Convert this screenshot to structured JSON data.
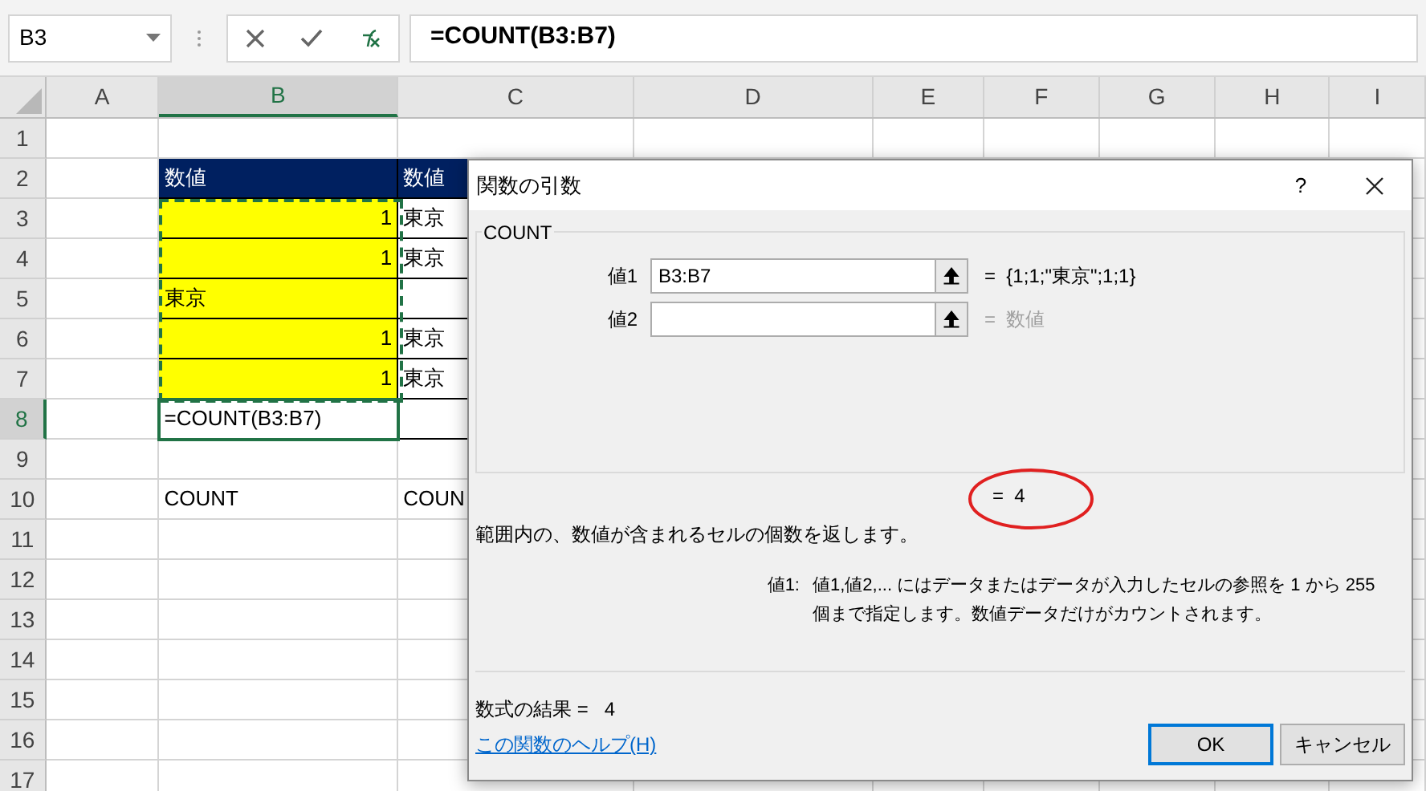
{
  "name_box": {
    "value": "B3"
  },
  "formula_bar": {
    "value": "=COUNT(B3:B7)"
  },
  "columns": [
    {
      "label": "A",
      "selected": false
    },
    {
      "label": "B",
      "selected": true
    },
    {
      "label": "C",
      "selected": false
    },
    {
      "label": "D",
      "selected": false
    },
    {
      "label": "E",
      "selected": false
    },
    {
      "label": "F",
      "selected": false
    },
    {
      "label": "G",
      "selected": false
    },
    {
      "label": "H",
      "selected": false
    },
    {
      "label": "I",
      "selected": false
    }
  ],
  "rows": [
    {
      "label": "1",
      "selected": false,
      "cells": []
    },
    {
      "label": "2",
      "selected": false,
      "cells": [
        {
          "kind": "empty",
          "boxed": false,
          "highlighted": false
        },
        {
          "kind": "header",
          "text": "数値",
          "boxed": true
        },
        {
          "kind": "header",
          "text": "数値",
          "boxed": true
        }
      ]
    },
    {
      "label": "3",
      "selected": false,
      "cells": [
        {
          "kind": "empty",
          "boxed": false,
          "highlighted": false
        },
        {
          "kind": "number",
          "text": "1",
          "boxed": true,
          "highlighted": true
        },
        {
          "kind": "text",
          "text": "東京",
          "boxed": true,
          "highlighted": false
        }
      ]
    },
    {
      "label": "4",
      "selected": false,
      "cells": [
        {
          "kind": "empty",
          "boxed": false,
          "highlighted": false
        },
        {
          "kind": "number",
          "text": "1",
          "boxed": true,
          "highlighted": true
        },
        {
          "kind": "text",
          "text": "東京",
          "boxed": true,
          "highlighted": false
        }
      ]
    },
    {
      "label": "5",
      "selected": false,
      "cells": [
        {
          "kind": "empty",
          "boxed": false,
          "highlighted": false
        },
        {
          "kind": "text",
          "text": "東京",
          "boxed": true,
          "highlighted": true
        },
        {
          "kind": "empty",
          "boxed": true,
          "highlighted": false
        }
      ]
    },
    {
      "label": "6",
      "selected": false,
      "cells": [
        {
          "kind": "empty",
          "boxed": false,
          "highlighted": false
        },
        {
          "kind": "number",
          "text": "1",
          "boxed": true,
          "highlighted": true
        },
        {
          "kind": "text",
          "text": "東京",
          "boxed": true,
          "highlighted": false
        }
      ]
    },
    {
      "label": "7",
      "selected": false,
      "cells": [
        {
          "kind": "empty",
          "boxed": false,
          "highlighted": false
        },
        {
          "kind": "number",
          "text": "1",
          "boxed": true,
          "highlighted": true
        },
        {
          "kind": "text",
          "text": "東京",
          "boxed": true,
          "highlighted": false
        }
      ]
    },
    {
      "label": "8",
      "selected": true,
      "cells": [
        {
          "kind": "empty",
          "boxed": false,
          "highlighted": false
        },
        {
          "kind": "text",
          "text": "=COUNT(B3:B7)",
          "boxed": false,
          "highlighted": false,
          "active": true
        },
        {
          "kind": "empty",
          "boxed": true,
          "highlighted": false
        }
      ]
    },
    {
      "label": "9",
      "selected": false,
      "cells": []
    },
    {
      "label": "10",
      "selected": false,
      "cells": [
        {
          "kind": "empty",
          "boxed": false,
          "highlighted": false
        },
        {
          "kind": "text",
          "text": "COUNT",
          "boxed": false,
          "highlighted": false
        },
        {
          "kind": "text",
          "text": "COUN",
          "boxed": false,
          "highlighted": false
        }
      ]
    },
    {
      "label": "11",
      "selected": false,
      "cells": []
    },
    {
      "label": "12",
      "selected": false,
      "cells": []
    },
    {
      "label": "13",
      "selected": false,
      "cells": []
    },
    {
      "label": "14",
      "selected": false,
      "cells": []
    },
    {
      "label": "15",
      "selected": false,
      "cells": []
    },
    {
      "label": "16",
      "selected": false,
      "cells": []
    },
    {
      "label": "17",
      "selected": false,
      "cells": []
    }
  ],
  "dialog": {
    "title": "関数の引数",
    "help": "?",
    "function_name": "COUNT",
    "arguments": [
      {
        "label": "値1",
        "value": "B3:B7",
        "result": "=  {1;1;\"東京\";1;1}",
        "dimmed": false
      },
      {
        "label": "値2",
        "result": "=  数値",
        "dimmed": true
      }
    ],
    "result": {
      "text": "=  4",
      "circled": true
    },
    "description": "範囲内の、数値が含まれるセルの個数を返します。",
    "argument_help": {
      "label": "値1:",
      "text": "値1,値2,... にはデータまたはデータが入力したセルの参照を 1 から 255 個まで指定します。数値データだけがカウントされます。"
    },
    "formula_result": {
      "label": "数式の結果 =",
      "value": "4"
    },
    "help_link": "この関数のヘルプ(H)",
    "buttons": [
      {
        "label": "OK",
        "default": true
      },
      {
        "label": "キャンセル",
        "default": false
      }
    ]
  }
}
